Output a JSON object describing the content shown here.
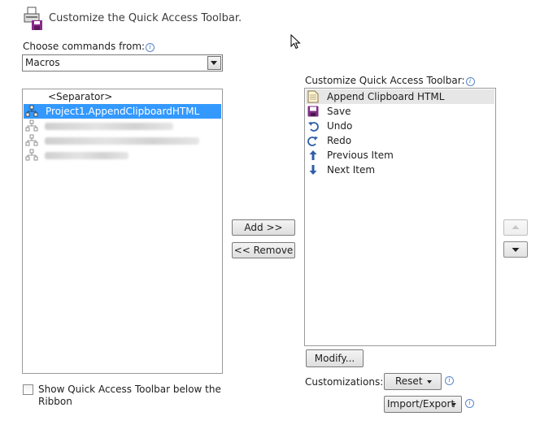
{
  "header": {
    "title": "Customize the Quick Access Toolbar."
  },
  "left": {
    "choose_label": "Choose commands from:",
    "combo_value": "Macros",
    "items": [
      {
        "label": "<Separator>"
      },
      {
        "label": "Project1.AppendClipboardHTML"
      }
    ]
  },
  "right": {
    "label": "Customize Quick Access Toolbar:",
    "items": [
      {
        "label": "Append Clipboard HTML",
        "icon": "document-icon"
      },
      {
        "label": "Save",
        "icon": "save-icon"
      },
      {
        "label": "Undo",
        "icon": "undo-icon"
      },
      {
        "label": "Redo",
        "icon": "redo-icon"
      },
      {
        "label": "Previous Item",
        "icon": "arrow-up-icon"
      },
      {
        "label": "Next Item",
        "icon": "arrow-down-icon"
      }
    ]
  },
  "buttons": {
    "add": "Add >>",
    "remove": "<< Remove",
    "modify": "Modify...",
    "reset": "Reset",
    "import_export": "Import/Export"
  },
  "customizations_label": "Customizations:",
  "checkbox_label_line1": "Show Quick Access Toolbar below the",
  "checkbox_label_line2": "Ribbon"
}
